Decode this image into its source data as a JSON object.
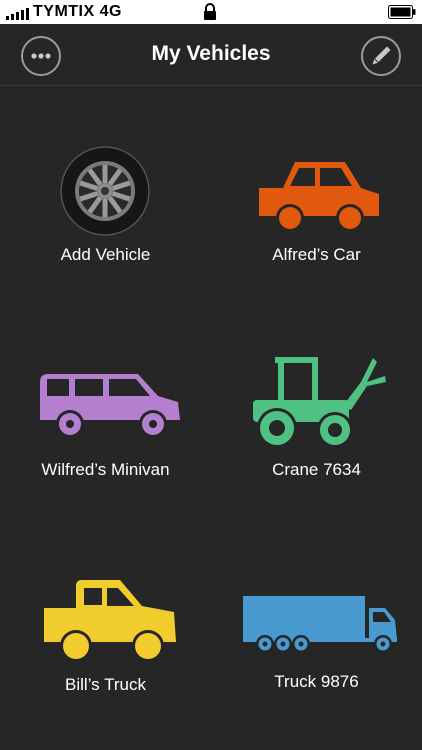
{
  "status_bar": {
    "carrier": "TYMTIX 4G",
    "icons": [
      "signal-bars-icon",
      "lock-icon",
      "battery-icon"
    ]
  },
  "nav": {
    "title": "My Vehicles",
    "menu_icon": "more-icon",
    "edit_icon": "pencil-icon"
  },
  "vehicles": [
    {
      "label": "Add Vehicle",
      "icon": "wheel-icon",
      "color": "#8a8a8a"
    },
    {
      "label": "Alfred’s Car",
      "icon": "car-icon",
      "color": "#e0590f"
    },
    {
      "label": "Wilfred’s Minivan",
      "icon": "minivan-icon",
      "color": "#b57fcf"
    },
    {
      "label": "Crane 7634",
      "icon": "crane-tractor-icon",
      "color": "#4fc283"
    },
    {
      "label": "Bill’s Truck",
      "icon": "pickup-truck-icon",
      "color": "#f0cc2c"
    },
    {
      "label": "Truck 9876",
      "icon": "semi-truck-icon",
      "color": "#4a9ad2"
    }
  ],
  "colors": {
    "background": "#262626",
    "status_bar": "#ffffff",
    "button_outline": "#9a9a9a"
  }
}
